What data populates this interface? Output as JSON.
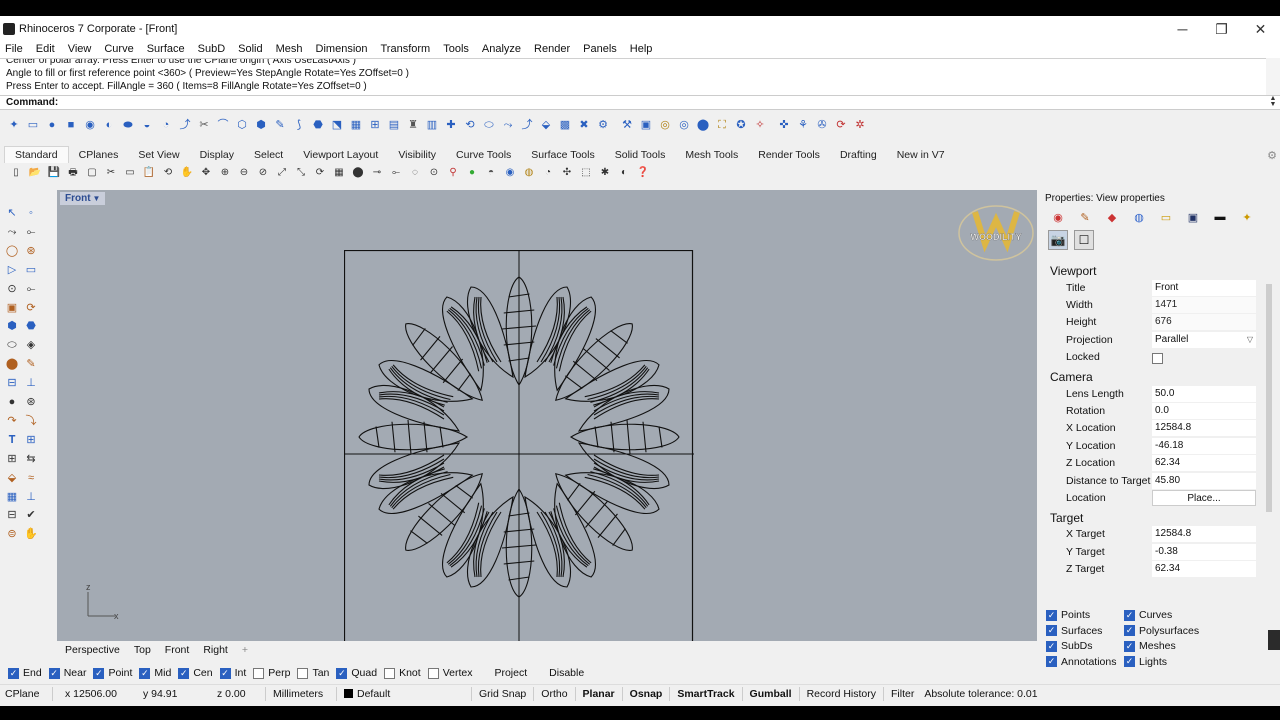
{
  "window": {
    "title": "Rhinoceros 7 Corporate - [Front]",
    "buttons": {
      "minimize": "─",
      "restore": "❐",
      "close": "✕"
    }
  },
  "menu": [
    "File",
    "Edit",
    "View",
    "Curve",
    "Surface",
    "SubD",
    "Solid",
    "Mesh",
    "Dimension",
    "Transform",
    "Tools",
    "Analyze",
    "Render",
    "Panels",
    "Help"
  ],
  "command_history": [
    "Center of polar array. Press Enter to use the CPlane origin ( Axis  UseLastAxis )",
    "Angle to fill or first reference point <360> ( Preview=Yes  StepAngle  Rotate=Yes  ZOffset=0 )",
    "Press Enter to accept. FillAngle = 360 ( Items=8  FillAngle  Rotate=Yes  ZOffset=0 )"
  ],
  "command_prompt": "Command:",
  "toolbar_tabs": [
    "Standard",
    "CPlanes",
    "Set View",
    "Display",
    "Select",
    "Viewport Layout",
    "Visibility",
    "Curve Tools",
    "Surface Tools",
    "Solid Tools",
    "Mesh Tools",
    "Render Tools",
    "Drafting",
    "New in V7"
  ],
  "toolbar_active_tab": "Standard",
  "viewport": {
    "title": "Front",
    "logo_text": "WOODILITY",
    "axis_z": "z",
    "axis_x": "x"
  },
  "viewport_tabs": [
    "Perspective",
    "Top",
    "Front",
    "Right"
  ],
  "snaps": [
    {
      "label": "End",
      "checked": true
    },
    {
      "label": "Near",
      "checked": true
    },
    {
      "label": "Point",
      "checked": true
    },
    {
      "label": "Mid",
      "checked": true
    },
    {
      "label": "Cen",
      "checked": true
    },
    {
      "label": "Int",
      "checked": true
    },
    {
      "label": "Perp",
      "checked": false
    },
    {
      "label": "Tan",
      "checked": false
    },
    {
      "label": "Quad",
      "checked": true
    },
    {
      "label": "Knot",
      "checked": false
    },
    {
      "label": "Vertex",
      "checked": false
    },
    {
      "label": "Project",
      "checked": false
    },
    {
      "label": "Disable",
      "checked": false
    }
  ],
  "status": {
    "cplane": "CPlane",
    "x": "x 12506.00",
    "y": "y 94.91",
    "z": "z 0.00",
    "units": "Millimeters",
    "layer": "Default",
    "grid_snap": "Grid Snap",
    "ortho": "Ortho",
    "planar": "Planar",
    "osnap": "Osnap",
    "smarttrack": "SmartTrack",
    "gumball": "Gumball",
    "record_history": "Record History",
    "filter": "Filter",
    "tolerance": "Absolute tolerance: 0.01",
    "layer_color": "#000000"
  },
  "panel": {
    "title": "Properties: View properties",
    "viewport_section": "Viewport",
    "viewport_props": [
      {
        "label": "Title",
        "value": "Front"
      },
      {
        "label": "Width",
        "value": "1471"
      },
      {
        "label": "Height",
        "value": "676"
      },
      {
        "label": "Projection",
        "value": "Parallel"
      },
      {
        "label": "Locked",
        "value": ""
      }
    ],
    "camera_section": "Camera",
    "camera_props": [
      {
        "label": "Lens Length",
        "value": "50.0"
      },
      {
        "label": "Rotation",
        "value": "0.0"
      },
      {
        "label": "X Location",
        "value": "12584.8"
      },
      {
        "label": "Y Location",
        "value": "-46.18"
      },
      {
        "label": "Z Location",
        "value": "62.34"
      },
      {
        "label": "Distance to Target",
        "value": "45.80"
      },
      {
        "label": "Location",
        "value": "Place..."
      }
    ],
    "target_section": "Target",
    "target_props": [
      {
        "label": "X Target",
        "value": "12584.8"
      },
      {
        "label": "Y Target",
        "value": "-0.38"
      },
      {
        "label": "Z Target",
        "value": "62.34"
      }
    ]
  },
  "filters": [
    {
      "label": "Points",
      "checked": true
    },
    {
      "label": "Curves",
      "checked": true
    },
    {
      "label": "Surfaces",
      "checked": true
    },
    {
      "label": "Polysurfaces",
      "checked": true
    },
    {
      "label": "SubDs",
      "checked": true
    },
    {
      "label": "Meshes",
      "checked": true
    },
    {
      "label": "Annotations",
      "checked": true
    },
    {
      "label": "Lights",
      "checked": true
    }
  ],
  "colors": {
    "accent": "#2a60c0",
    "viewport_bg": "#a3aab3",
    "title_highlight": "#c9cedb"
  }
}
